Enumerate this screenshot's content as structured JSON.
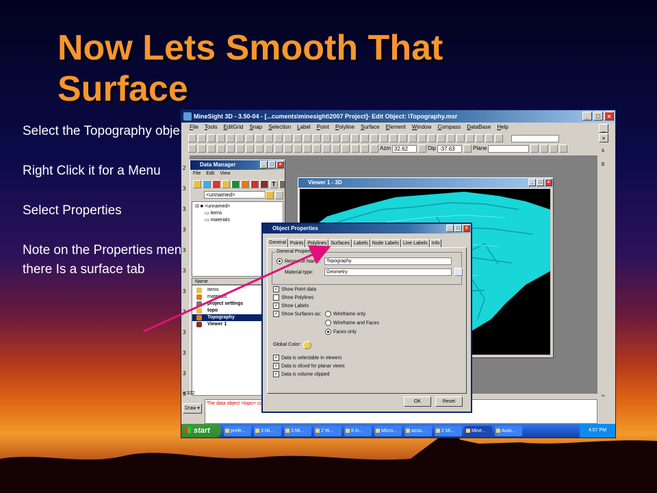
{
  "slide": {
    "title": "Now Lets Smooth That Surface",
    "bullets": [
      "Select the Topography object",
      "Right Click it for a Menu",
      "Select Properties",
      "Note on the Properties menu there Is a surface tab"
    ]
  },
  "app": {
    "title": "MineSight 3D - 3.50-04 - [...cuments\\minesight\\2007 Project]- Edit Object: \\Topography.msr",
    "menu": [
      "File",
      "Tools",
      "EditGrid",
      "Snap",
      "Selection",
      "Label",
      "Point",
      "Polyline",
      "Surface",
      "Element",
      "Window",
      "Compass",
      "DataBase",
      "Help"
    ],
    "toolbar": {
      "azm_label": "Azm",
      "azm_value": "32.62",
      "dip_label": "Dip",
      "dip_value": "-37.63",
      "plane_label": "Plane"
    },
    "left_gutter_digits": [
      "2",
      "3",
      "3",
      "3",
      "3",
      "3",
      "3",
      "3",
      "3",
      "3",
      "3",
      "3"
    ],
    "right_gutter": [
      "s",
      "b",
      "ls"
    ],
    "coord_prefix": "e:322",
    "draw_label": "Draw",
    "status_message": "The data object <topo> con"
  },
  "data_manager": {
    "title": "Data Manager",
    "menu": [
      "File",
      "Edit",
      "View"
    ],
    "path_value": "<unnamed>",
    "tree": {
      "root": "<unnamed>",
      "children": [
        "items",
        "materials"
      ]
    },
    "list_header": "Name",
    "list_items": [
      "items",
      "materials",
      "project settings",
      "topo",
      "Topography",
      "Viewer 1"
    ],
    "selected_item": "Topography"
  },
  "viewer": {
    "title": "Viewer 1 - 3D",
    "surface_color": "#00e5e8"
  },
  "dialog": {
    "title": "Object Properties",
    "tabs": [
      "General",
      "Points",
      "Polylines",
      "Surfaces",
      "Labels",
      "Node Labels",
      "Line Labels",
      "Info"
    ],
    "active_tab": "General",
    "group_label": "General Properties",
    "resource_name_label": "Resource Name:",
    "resource_name_value": "Topography",
    "material_type_label": "Material type:",
    "material_type_value": "Geometry",
    "checks": [
      {
        "label": "Show Point data",
        "checked": true
      },
      {
        "label": "Show Polylines",
        "checked": false
      },
      {
        "label": "Show Labels",
        "checked": true
      },
      {
        "label": "Show Surfaces as:",
        "checked": true
      }
    ],
    "surface_modes": [
      {
        "label": "Wireframe only",
        "on": false
      },
      {
        "label": "Wireframe and Faces",
        "on": false
      },
      {
        "label": "Faces only",
        "on": true
      }
    ],
    "global_color_label": "Global Color:",
    "bottom_checks": [
      {
        "label": "Data is selectable in viewers",
        "checked": true
      },
      {
        "label": "Data is sliced for planar views",
        "checked": true
      },
      {
        "label": "Data is volume clipped",
        "checked": true
      }
    ],
    "ok_label": "OK",
    "reset_label": "Reset"
  },
  "taskbar": {
    "start_label": "start",
    "items": [
      "prefe...",
      "3 Mi...",
      "3 Mi...",
      "2 W...",
      "8 In...",
      "Micro...",
      "assa...",
      "2 Mi...",
      "Mine...",
      "Auto..."
    ],
    "active_index": 8,
    "clock": "4:57 PM"
  },
  "colors": {
    "title_orange": "#f7962e",
    "arrow_magenta": "#e0107a",
    "selection_navy": "#0a246a"
  }
}
